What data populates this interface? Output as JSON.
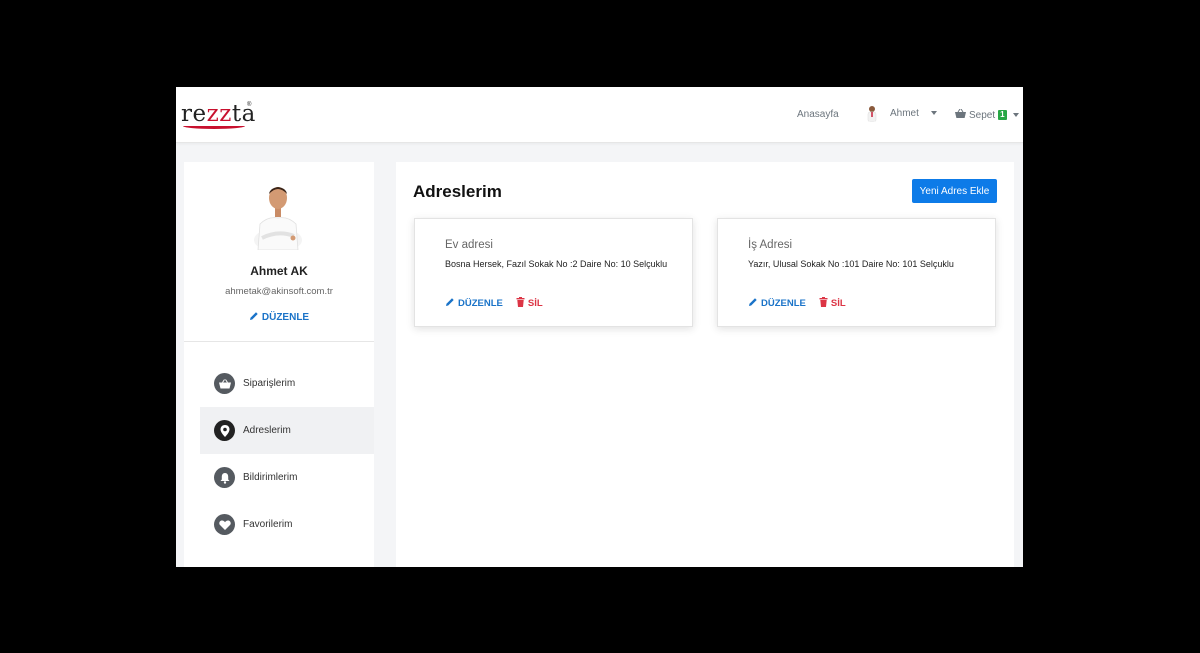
{
  "navbar": {
    "logo": {
      "part1": "re",
      "part2": "zz",
      "part3": "ta",
      "reg": "®"
    },
    "home": "Anasayfa",
    "user_name": "Ahmet",
    "cart_label": "Sepet",
    "cart_count": "1"
  },
  "profile": {
    "name": "Ahmet AK",
    "email": "ahmetak@akinsoft.com.tr",
    "edit": "DÜZENLE"
  },
  "menu": {
    "items": [
      {
        "label": "Siparişlerim",
        "icon": "basket-icon"
      },
      {
        "label": "Adreslerim",
        "icon": "map-pin-icon"
      },
      {
        "label": "Bildirimlerim",
        "icon": "bell-icon"
      },
      {
        "label": "Favorilerim",
        "icon": "heart-icon"
      }
    ],
    "active": "Adreslerim"
  },
  "main": {
    "title": "Adreslerim",
    "new_button": "Yeni Adres Ekle",
    "addresses": [
      {
        "title": "Ev adresi",
        "address": "Bosna Hersek, Fazıl Sokak No :2 Daire No: 10 Selçuklu",
        "edit": "DÜZENLE",
        "delete": "SİL"
      },
      {
        "title": "İş Adresi",
        "address": "Yazır, Ulusal Sokak No :101 Daire No: 101 Selçuklu",
        "edit": "DÜZENLE",
        "delete": "SİL"
      }
    ]
  },
  "colors": {
    "accent": "#0d7be8",
    "link": "#1a73c8",
    "danger": "#dc3545",
    "badge": "#28a745"
  }
}
